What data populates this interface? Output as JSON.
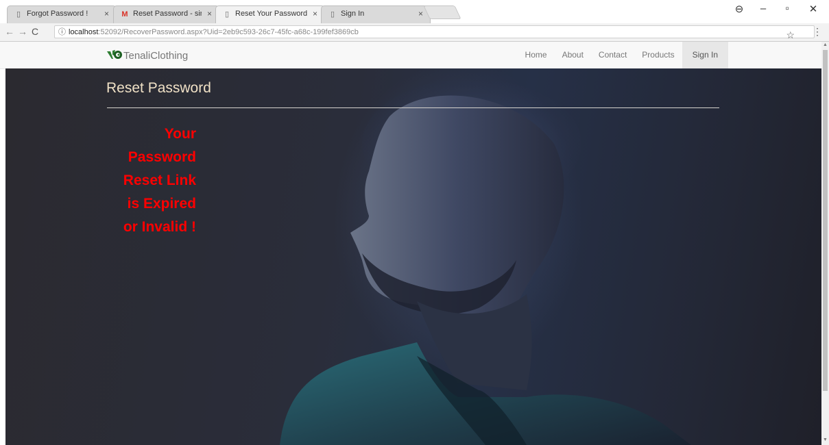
{
  "browser": {
    "tabs": [
      {
        "label": "Forgot Password !",
        "icon": "document-icon",
        "close": "×"
      },
      {
        "label": "Reset Password - singha",
        "icon": "gmail-icon",
        "close": "×"
      },
      {
        "label": "Reset Your Password",
        "icon": "document-icon",
        "close": "×"
      },
      {
        "label": "Sign In",
        "icon": "document-icon",
        "close": "×"
      }
    ],
    "url_host": "localhost",
    "url_rest": ":52092/RecoverPassword.aspx?Uid=2eb9c593-26c7-45fc-a68c-199fef3869cb"
  },
  "site": {
    "brand": "TenaliClothing",
    "nav": [
      "Home",
      "About",
      "Contact",
      "Products",
      "Sign In"
    ],
    "page_title": "Reset Password",
    "message_lines": [
      "Your",
      "Password",
      "Reset Link",
      "is Expired",
      "or Invalid !"
    ]
  },
  "colors": {
    "message": "#ff0000",
    "title": "#f0e1c6"
  }
}
